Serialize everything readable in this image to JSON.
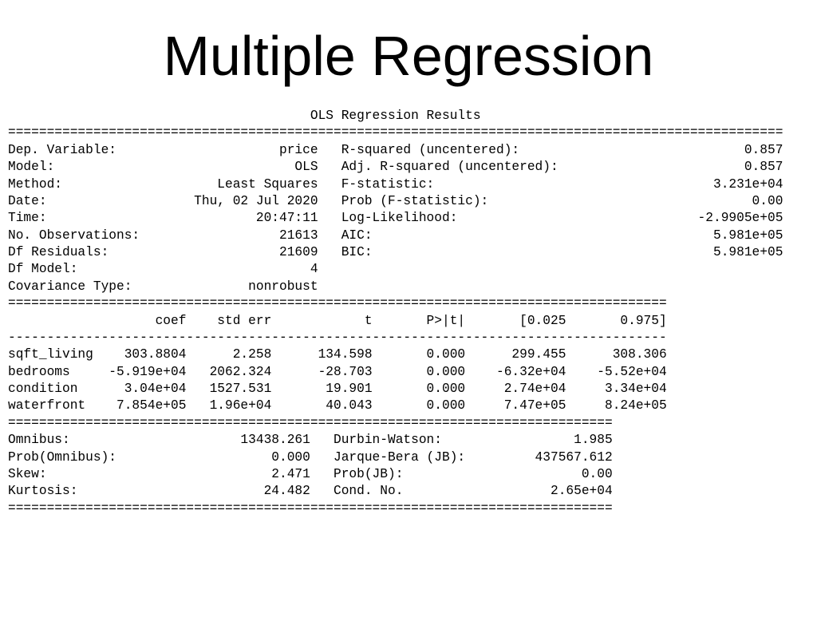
{
  "title": "Multiple Regression",
  "results_title": "OLS Regression Results",
  "top_left": [
    {
      "label": "Dep. Variable:",
      "value": "price"
    },
    {
      "label": "Model:",
      "value": "OLS"
    },
    {
      "label": "Method:",
      "value": "Least Squares"
    },
    {
      "label": "Date:",
      "value": "Thu, 02 Jul 2020"
    },
    {
      "label": "Time:",
      "value": "20:47:11"
    },
    {
      "label": "No. Observations:",
      "value": "21613"
    },
    {
      "label": "Df Residuals:",
      "value": "21609"
    },
    {
      "label": "Df Model:",
      "value": "4"
    },
    {
      "label": "Covariance Type:",
      "value": "nonrobust"
    }
  ],
  "top_right": [
    {
      "label": "R-squared (uncentered):",
      "value": "0.857"
    },
    {
      "label": "Adj. R-squared (uncentered):",
      "value": "0.857"
    },
    {
      "label": "F-statistic:",
      "value": "3.231e+04"
    },
    {
      "label": "Prob (F-statistic):",
      "value": "0.00"
    },
    {
      "label": "Log-Likelihood:",
      "value": "-2.9905e+05"
    },
    {
      "label": "AIC:",
      "value": "5.981e+05"
    },
    {
      "label": "BIC:",
      "value": "5.981e+05"
    }
  ],
  "coef_headers": [
    "",
    "coef",
    "std err",
    "t",
    "P>|t|",
    "[0.025",
    "0.975]"
  ],
  "coef_rows": [
    {
      "name": "sqft_living",
      "coef": "303.8804",
      "stderr": "2.258",
      "t": "134.598",
      "p": "0.000",
      "lo": "299.455",
      "hi": "308.306"
    },
    {
      "name": "bedrooms",
      "coef": "-5.919e+04",
      "stderr": "2062.324",
      "t": "-28.703",
      "p": "0.000",
      "lo": "-6.32e+04",
      "hi": "-5.52e+04"
    },
    {
      "name": "condition",
      "coef": "3.04e+04",
      "stderr": "1527.531",
      "t": "19.901",
      "p": "0.000",
      "lo": "2.74e+04",
      "hi": "3.34e+04"
    },
    {
      "name": "waterfront",
      "coef": "7.854e+05",
      "stderr": "1.96e+04",
      "t": "40.043",
      "p": "0.000",
      "lo": "7.47e+05",
      "hi": "8.24e+05"
    }
  ],
  "bottom_left": [
    {
      "label": "Omnibus:",
      "value": "13438.261"
    },
    {
      "label": "Prob(Omnibus):",
      "value": "0.000"
    },
    {
      "label": "Skew:",
      "value": "2.471"
    },
    {
      "label": "Kurtosis:",
      "value": "24.482"
    }
  ],
  "bottom_right": [
    {
      "label": "Durbin-Watson:",
      "value": "1.985"
    },
    {
      "label": "Jarque-Bera (JB):",
      "value": "437567.612"
    },
    {
      "label": "Prob(JB):",
      "value": "0.00"
    },
    {
      "label": "Cond. No.",
      "value": "2.65e+04"
    }
  ],
  "chart_data": {
    "type": "table",
    "title": "OLS Regression Results",
    "dep_variable": "price",
    "model": "OLS",
    "method": "Least Squares",
    "observations": 21613,
    "df_residuals": 21609,
    "df_model": 4,
    "r_squared_uncentered": 0.857,
    "adj_r_squared_uncentered": 0.857,
    "f_statistic": 32310,
    "prob_f_statistic": 0.0,
    "log_likelihood": -299050,
    "aic": 598100,
    "bic": 598100,
    "coefficients": [
      {
        "variable": "sqft_living",
        "coef": 303.8804,
        "std_err": 2.258,
        "t": 134.598,
        "p": 0.0,
        "ci_low": 299.455,
        "ci_high": 308.306
      },
      {
        "variable": "bedrooms",
        "coef": -59190,
        "std_err": 2062.324,
        "t": -28.703,
        "p": 0.0,
        "ci_low": -63200,
        "ci_high": -55200
      },
      {
        "variable": "condition",
        "coef": 30400,
        "std_err": 1527.531,
        "t": 19.901,
        "p": 0.0,
        "ci_low": 27400,
        "ci_high": 33400
      },
      {
        "variable": "waterfront",
        "coef": 785400,
        "std_err": 19600,
        "t": 40.043,
        "p": 0.0,
        "ci_low": 747000,
        "ci_high": 824000
      }
    ],
    "diagnostics": {
      "omnibus": 13438.261,
      "prob_omnibus": 0.0,
      "skew": 2.471,
      "kurtosis": 24.482,
      "durbin_watson": 1.985,
      "jarque_bera": 437567.612,
      "prob_jb": 0.0,
      "cond_no": 26500
    }
  }
}
